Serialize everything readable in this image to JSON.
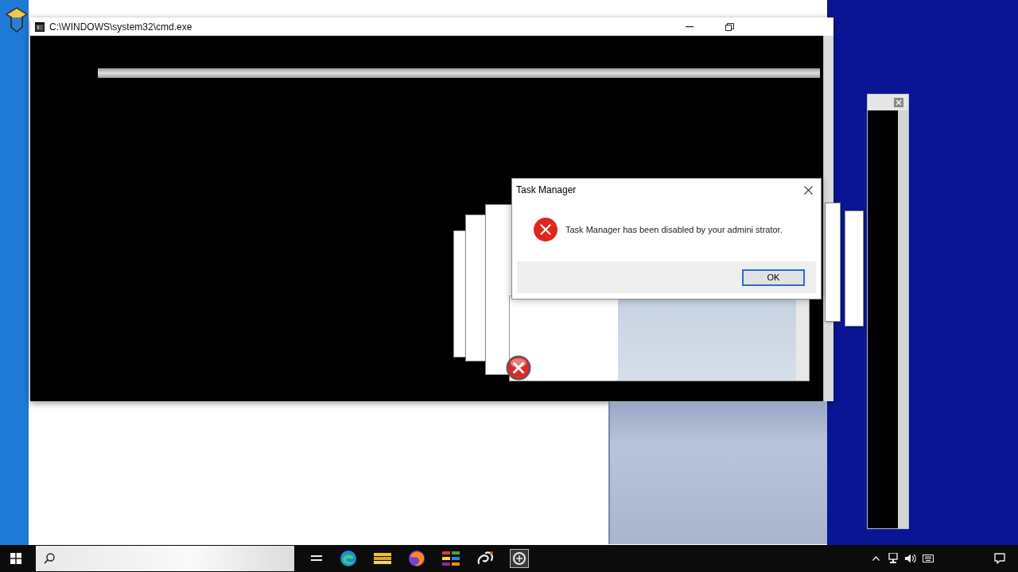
{
  "console_window": {
    "title": "C:\\WINDOWS\\system32\\cmd.exe"
  },
  "dialog": {
    "title": "Task Manager",
    "message": "Task Manager has been disabled by your admini strator.",
    "buttons": [
      {
        "label": "OK",
        "focused": true
      }
    ]
  }
}
